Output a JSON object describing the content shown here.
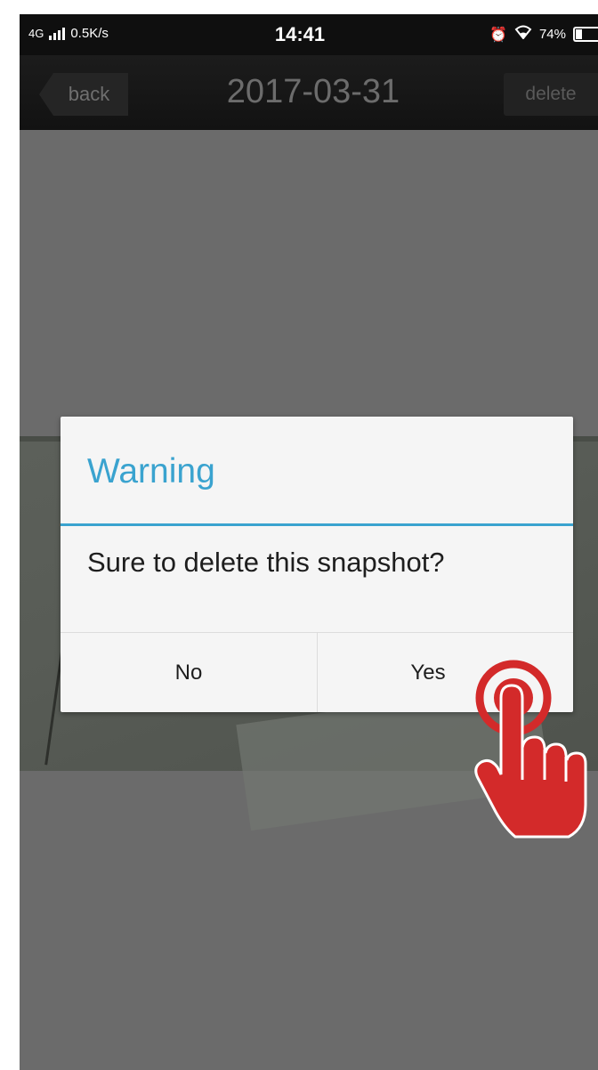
{
  "status_bar": {
    "network": "4G",
    "speed": "0.5K/s",
    "time": "14:41",
    "battery": "74%"
  },
  "nav": {
    "back_label": "back",
    "title": "2017-03-31",
    "delete_label": "delete"
  },
  "dialog": {
    "title": "Warning",
    "message": "Sure to delete this snapshot?",
    "no_label": "No",
    "yes_label": "Yes"
  },
  "colors": {
    "accent": "#3aa3cf",
    "tap_hint": "#d32a2a"
  },
  "icons": [
    "signal-icon",
    "alarm-icon",
    "wifi-icon",
    "battery-icon",
    "hand-pointer-icon"
  ]
}
